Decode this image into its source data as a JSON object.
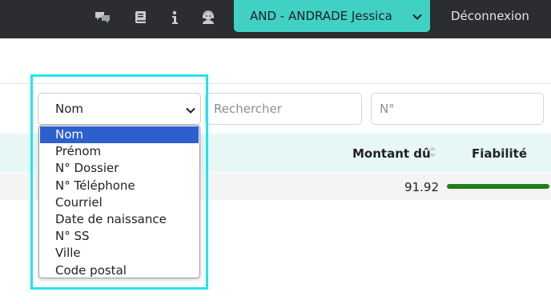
{
  "topbar": {
    "icons": [
      "chat-icon",
      "book-icon",
      "info-icon",
      "support-agent-icon"
    ],
    "user_select_label": "AND - ANDRADE Jessica",
    "logout_label": "Déconnexion",
    "colors": {
      "background": "#2b2d31",
      "accent": "#41d1c4"
    }
  },
  "filters": {
    "field_select_value": "Nom",
    "search_placeholder": "Rechercher",
    "number_placeholder": "N°",
    "options": [
      {
        "label": "Nom",
        "selected": true
      },
      {
        "label": "Prénom",
        "selected": false
      },
      {
        "label": "N° Dossier",
        "selected": false
      },
      {
        "label": "N° Téléphone",
        "selected": false
      },
      {
        "label": "Courriel",
        "selected": false
      },
      {
        "label": "Date de naissance",
        "selected": false
      },
      {
        "label": "N° SS",
        "selected": false
      },
      {
        "label": "Ville",
        "selected": false
      },
      {
        "label": "Code postal",
        "selected": false
      }
    ]
  },
  "table": {
    "columns": {
      "amount": "Montant dû",
      "reliability": "Fiabilité"
    },
    "rows": [
      {
        "amount": "91.92",
        "reliability_level": 1.0
      }
    ],
    "colors": {
      "header_bg": "#e7f7f6",
      "bar": "#1f7f16"
    }
  }
}
